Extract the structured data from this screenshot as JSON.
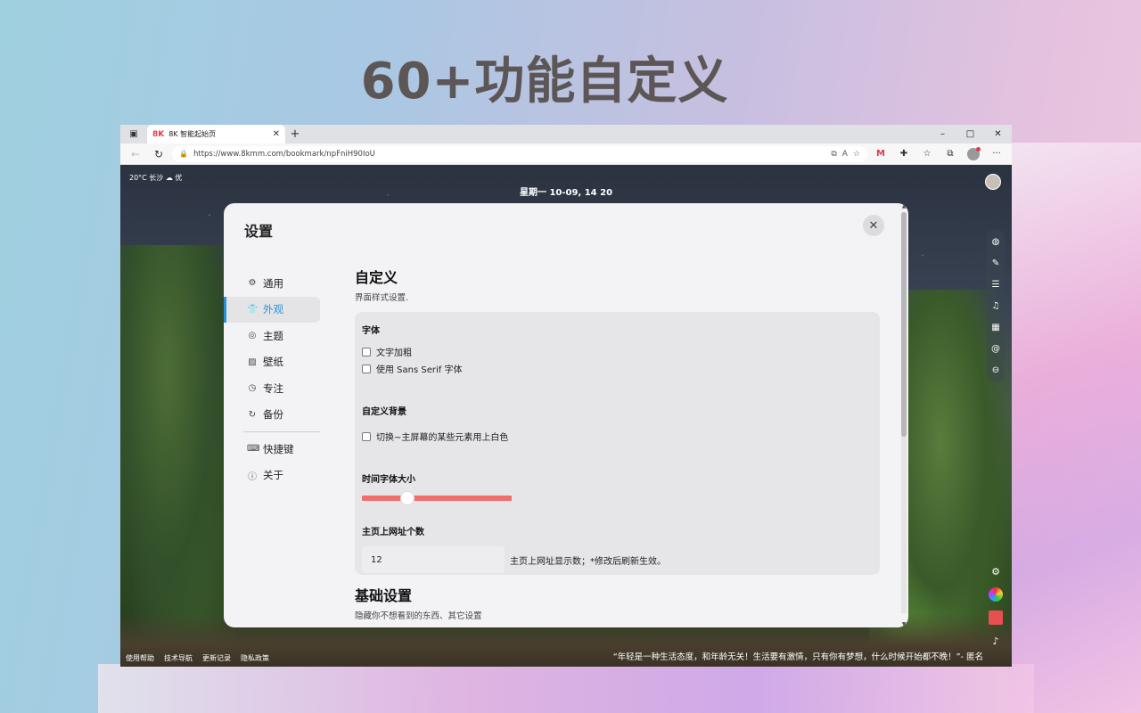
{
  "hero": {
    "title": "60+功能自定义"
  },
  "browser": {
    "tab": {
      "favicon": "8K",
      "title": "8K 智能起始页"
    },
    "url": "https://www.8kmm.com/bookmark/npFniH90IoU",
    "window_controls": {
      "minimize": "–",
      "maximize": "□",
      "close": "✕"
    }
  },
  "page": {
    "weather": "20°C 长沙 ☁ 优",
    "clock": "星期一 10-09, 14 20",
    "footer_links": [
      "使用帮助",
      "技术导航",
      "更新记录",
      "隐私政策"
    ],
    "quote": "“年轻是一种生活态度，和年龄无关！生活要有激情，只有你有梦想，什么时候开始都不晚！”- 匿名"
  },
  "settings": {
    "title": "设置",
    "menu": [
      {
        "icon": "gear-icon",
        "glyph": "⚙",
        "label": "通用"
      },
      {
        "icon": "shirt-icon",
        "glyph": "👕",
        "label": "外观",
        "active": true
      },
      {
        "icon": "palette-icon",
        "glyph": "◎",
        "label": "主题"
      },
      {
        "icon": "image-icon",
        "glyph": "▨",
        "label": "壁纸"
      },
      {
        "icon": "timer-icon",
        "glyph": "◷",
        "label": "专注"
      },
      {
        "icon": "backup-icon",
        "glyph": "↻",
        "label": "备份"
      }
    ],
    "menu_secondary": [
      {
        "icon": "keyboard-icon",
        "glyph": "⌨",
        "label": "快捷键"
      },
      {
        "icon": "info-icon",
        "glyph": "ⓘ",
        "label": "关于"
      }
    ],
    "section1": {
      "title": "自定义",
      "subtitle": "界面样式设置.",
      "font_group": {
        "title": "字体",
        "options": [
          {
            "label": "文字加粗",
            "checked": false
          },
          {
            "label": "使用 Sans Serif 字体",
            "checked": false
          }
        ]
      },
      "background_group": {
        "title": "自定义背景",
        "option": {
          "label": "切换~主屏幕的某些元素用上白色",
          "checked": false
        }
      },
      "time_font_size": {
        "title": "时间字体大小",
        "value_fraction": 0.3
      },
      "url_count": {
        "title": "主页上网址个数",
        "value": "12",
        "hint": "主页上网址显示数；*修改后刷新生效。"
      }
    },
    "section2": {
      "title": "基础设置",
      "subtitle": "隐藏你不想看到的东西、其它设置"
    }
  }
}
